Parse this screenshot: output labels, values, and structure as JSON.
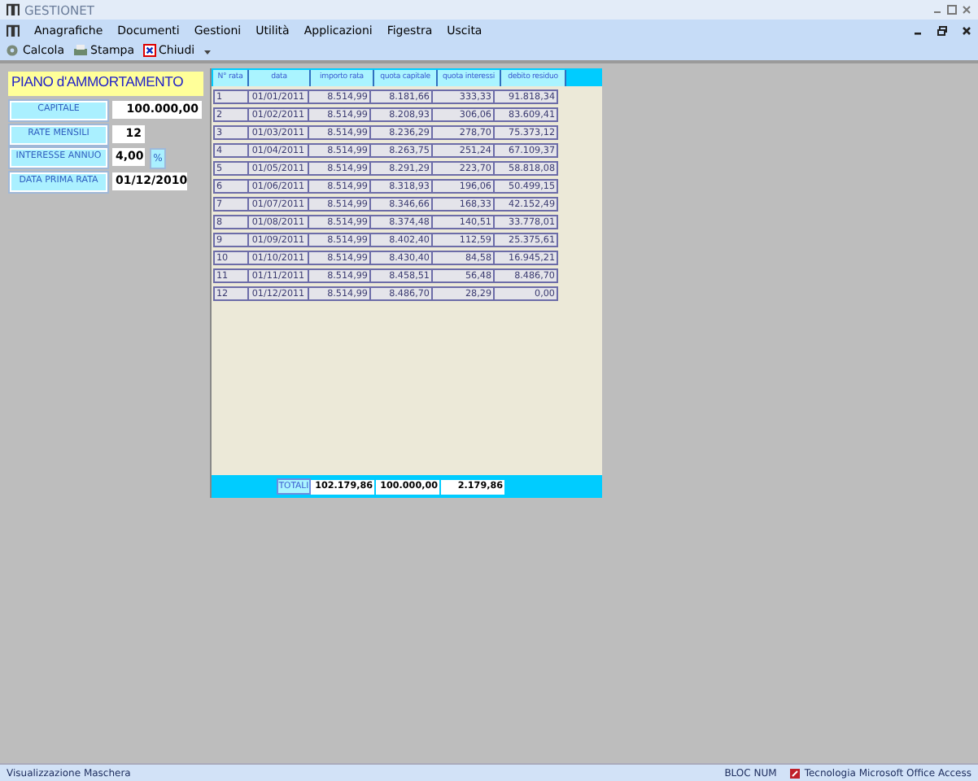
{
  "window": {
    "title": "GESTIONET"
  },
  "menu": [
    "Anagrafiche",
    "Documenti",
    "Gestioni",
    "Utilità",
    "Applicazioni",
    "Figestra",
    "Uscita"
  ],
  "toolbar": [
    {
      "label": "Calcola",
      "kind": "calc"
    },
    {
      "label": "Stampa",
      "kind": "print"
    },
    {
      "label": "Chiudi",
      "kind": "close"
    }
  ],
  "form": {
    "title": "PIANO d'AMMORTAMENTO",
    "fields": [
      {
        "label": "CAPITALE",
        "value": "100.000,00",
        "kind": "wide"
      },
      {
        "label": "RATE MENSILI",
        "value": "12",
        "kind": "short"
      },
      {
        "label": "INTERESSE ANNUO",
        "value": "4,00",
        "kind": "percent",
        "suffix": "%"
      },
      {
        "label": "DATA PRIMA RATA",
        "value": "01/12/2010",
        "kind": "date"
      }
    ]
  },
  "table": {
    "columns": [
      "N° rata",
      "data",
      "importo rata",
      "quota capitale",
      "quota interessi",
      "debito residuo"
    ],
    "rows": [
      [
        "1",
        "01/01/2011",
        "8.514,99",
        "8.181,66",
        "333,33",
        "91.818,34"
      ],
      [
        "2",
        "01/02/2011",
        "8.514,99",
        "8.208,93",
        "306,06",
        "83.609,41"
      ],
      [
        "3",
        "01/03/2011",
        "8.514,99",
        "8.236,29",
        "278,70",
        "75.373,12"
      ],
      [
        "4",
        "01/04/2011",
        "8.514,99",
        "8.263,75",
        "251,24",
        "67.109,37"
      ],
      [
        "5",
        "01/05/2011",
        "8.514,99",
        "8.291,29",
        "223,70",
        "58.818,08"
      ],
      [
        "6",
        "01/06/2011",
        "8.514,99",
        "8.318,93",
        "196,06",
        "50.499,15"
      ],
      [
        "7",
        "01/07/2011",
        "8.514,99",
        "8.346,66",
        "168,33",
        "42.152,49"
      ],
      [
        "8",
        "01/08/2011",
        "8.514,99",
        "8.374,48",
        "140,51",
        "33.778,01"
      ],
      [
        "9",
        "01/09/2011",
        "8.514,99",
        "8.402,40",
        "112,59",
        "25.375,61"
      ],
      [
        "10",
        "01/10/2011",
        "8.514,99",
        "8.430,40",
        "84,58",
        "16.945,21"
      ],
      [
        "11",
        "01/11/2011",
        "8.514,99",
        "8.458,51",
        "56,48",
        "8.486,70"
      ],
      [
        "12",
        "01/12/2011",
        "8.514,99",
        "8.486,70",
        "28,29",
        "0,00"
      ]
    ],
    "totals": {
      "label": "TOTALI",
      "values": [
        "102.179,86",
        "100.000,00",
        "2.179,86"
      ]
    }
  },
  "status_bar": {
    "left": "Visualizzazione Maschera",
    "num": "BLOC NUM",
    "app": "Tecnologia Microsoft Office Access"
  }
}
